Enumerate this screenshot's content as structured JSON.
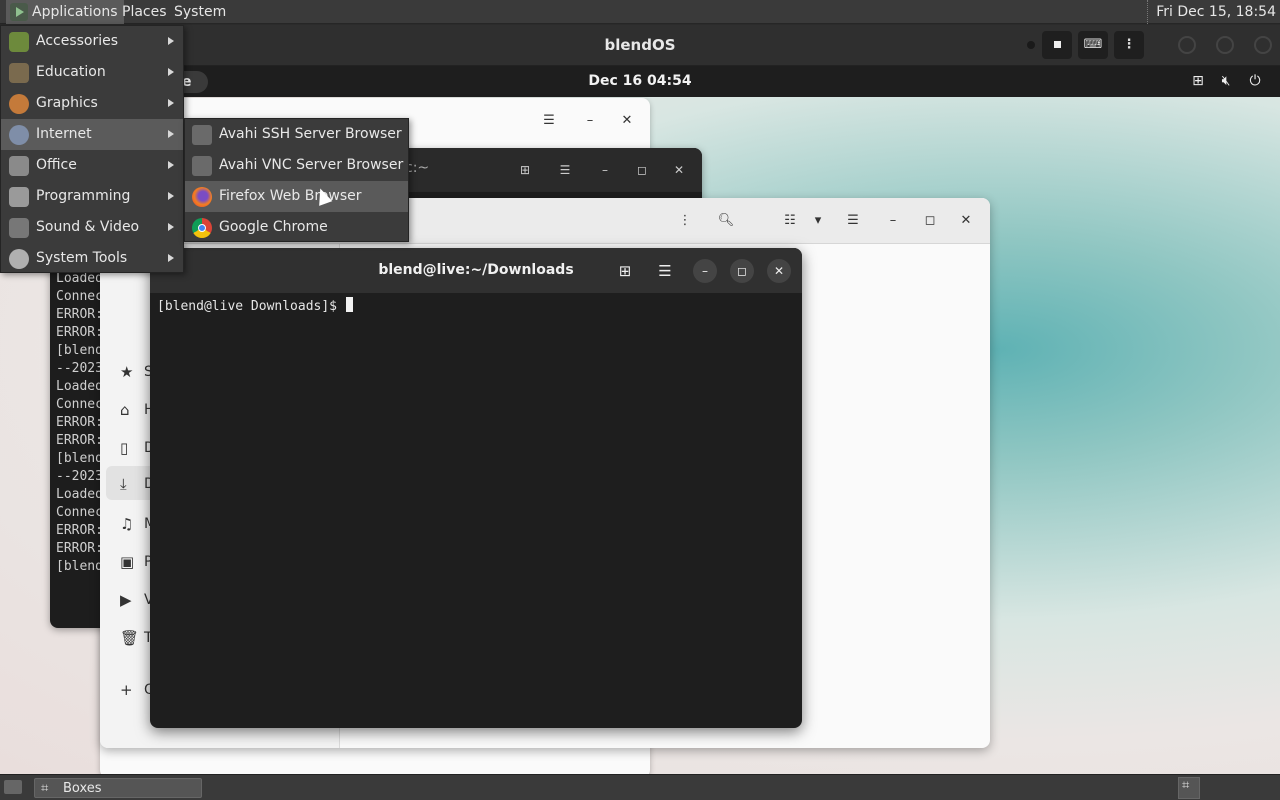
{
  "host_panel": {
    "menus": [
      "Applications",
      "Places",
      "System"
    ],
    "clock": "Fri Dec 15, 18:54"
  },
  "host_window": {
    "title": "blendOS"
  },
  "guest_panel": {
    "activities_fragment": "e",
    "clock": "Dec 16  04:54"
  },
  "apps_menu": {
    "items": [
      "Accessories",
      "Education",
      "Graphics",
      "Internet",
      "Office",
      "Programming",
      "Sound & Video",
      "System Tools"
    ],
    "selected": "Internet"
  },
  "internet_submenu": {
    "items": [
      "Avahi SSH Server Browser",
      "Avahi VNC Server Browser",
      "Firefox Web Browser",
      "Google Chrome"
    ],
    "highlighted": "Firefox Web Browser"
  },
  "back_terminal": {
    "title_fragment": "c:~",
    "lines": [
      "Loaded",
      "Connec",
      "ERROR:",
      "ERROR:",
      "[blend",
      "--2023",
      "Loaded",
      "Connec",
      "ERROR:",
      "ERROR:",
      "[blend",
      "--2023",
      "Loaded",
      "Connec",
      "ERROR:",
      "ERROR:",
      "[blend"
    ]
  },
  "files_window": {
    "sidebar_fragments": [
      "S",
      "H",
      "D",
      "D",
      "M",
      "P",
      "V",
      "T",
      "O"
    ]
  },
  "terminal": {
    "title": "blend@live:~/Downloads",
    "prompt": "[blend@live Downloads]$ "
  },
  "taskbar": {
    "items": [
      "Boxes"
    ]
  },
  "colors": {
    "menu_bg": "#3b3b3b",
    "menu_selected": "#5b5b5b",
    "terminal_bg": "#1e1e1e"
  }
}
